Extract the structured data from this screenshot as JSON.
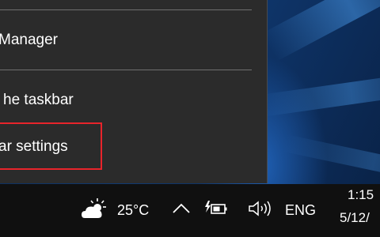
{
  "context_menu": {
    "items": [
      {
        "label": "Manager"
      },
      {
        "label": "he taskbar"
      },
      {
        "label": "ar settings"
      }
    ]
  },
  "taskbar": {
    "weather": {
      "icon": "partly-cloudy-icon",
      "temperature": "25°C"
    },
    "show_hidden_icons": {
      "icon": "chevron-up-icon"
    },
    "battery": {
      "icon": "battery-charging-icon"
    },
    "volume": {
      "icon": "speaker-icon"
    },
    "language": "ENG",
    "clock": {
      "time": "1:15",
      "date": "5/12/"
    }
  },
  "colors": {
    "menu_background": "#2b2b2b",
    "highlight_border": "#e8242b",
    "taskbar_background": "#101010"
  }
}
